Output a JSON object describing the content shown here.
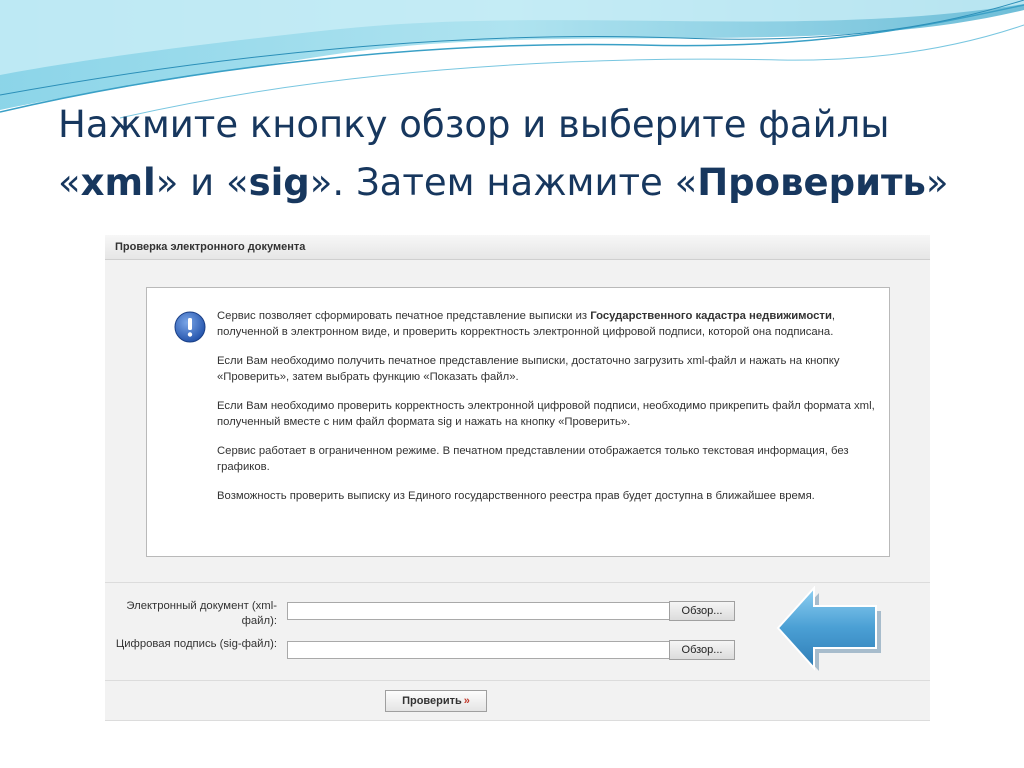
{
  "slide": {
    "title_line1": "Нажмите кнопку обзор и выберите файлы",
    "title_q1_open": "«",
    "title_q1_word": "xml",
    "title_q1_close": "» и «",
    "title_q2_word": "sig",
    "title_q2_close": "». Затем нажмите «",
    "title_q3_word": "Проверить",
    "title_q3_close": "»"
  },
  "panel": {
    "header": "Проверка электронного документа",
    "info": {
      "icon": "info-circle-icon",
      "p1_start": "Сервис позволяет сформировать печатное представление выписки из ",
      "p1_bold": "Государственного кадастра недвижимости",
      "p1_end": ", полученной в электронном виде, и проверить корректность электронной цифровой подписи, которой она подписана.",
      "p2": "Если Вам необходимо получить печатное представление выписки, достаточно загрузить xml-файл и нажать на кнопку «Проверить», затем выбрать функцию «Показать файл».",
      "p3": "Если Вам необходимо проверить корректность электронной цифровой подписи, необходимо прикрепить файл формата xml, полученный вместе с ним файл формата sig и нажать на кнопку «Проверить».",
      "p4": "Сервис работает в ограниченном режиме. В печатном представлении отображается только текстовая информация, без графиков.",
      "p5": "Возможность проверить выписку из Единого государственного реестра прав будет доступна в ближайшее время."
    },
    "form": {
      "xml_label": "Электронный документ (xml-файл):",
      "sig_label": "Цифровая подпись (sig-файл):",
      "browse_label": "Обзор...",
      "submit_label": "Проверить",
      "submit_arrow": "»"
    }
  },
  "colors": {
    "title": "#17375e",
    "arrow": "#4a9fd4",
    "wave": "#5bbad6"
  },
  "decor": {
    "arrow_icon": "arrow-left-icon",
    "waves": "wave-decoration"
  }
}
